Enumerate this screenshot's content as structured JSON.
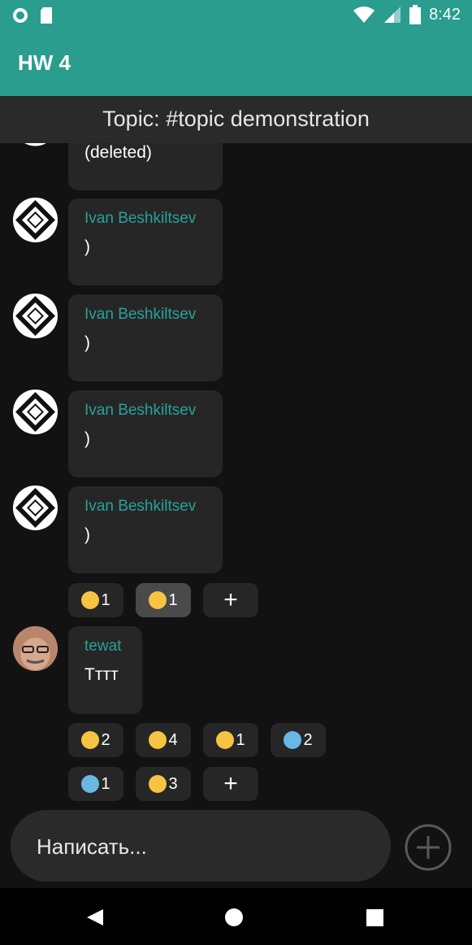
{
  "status_bar": {
    "time": "8:42",
    "icons": [
      "notification-circle-icon",
      "sd-card-icon",
      "wifi-icon",
      "signal-icon",
      "battery-icon"
    ]
  },
  "app": {
    "title": "HW 4",
    "accent_color": "#2a9d8f"
  },
  "topic": {
    "label": "Topic: #topic demonstration"
  },
  "messages": [
    {
      "sender": "",
      "text": "(deleted)"
    },
    {
      "sender": "Ivan Beshkiltsev",
      "text": ")"
    },
    {
      "sender": "Ivan Beshkiltsev",
      "text": ")"
    },
    {
      "sender": "Ivan Beshkiltsev",
      "text": ")"
    },
    {
      "sender": "Ivan Beshkiltsev",
      "text": ")",
      "reactions": [
        {
          "emoji": "yum-emoji",
          "count": "1",
          "selected": false
        },
        {
          "emoji": "grin-emoji",
          "count": "1",
          "selected": true
        }
      ]
    },
    {
      "sender": "tewat",
      "text": "Тттт",
      "reactions": [
        {
          "emoji": "cowboy-emoji",
          "count": "2"
        },
        {
          "emoji": "astonished-emoji",
          "count": "4"
        },
        {
          "emoji": "sunglasses-emoji",
          "count": "1"
        },
        {
          "emoji": "scream-emoji",
          "count": "2"
        },
        {
          "emoji": "anxious-emoji",
          "count": "1"
        },
        {
          "emoji": "sleeping-emoji",
          "count": "3"
        }
      ]
    }
  ],
  "composer": {
    "placeholder": "Написать..."
  },
  "navigation": [
    "back-icon",
    "home-icon",
    "recents-icon"
  ]
}
